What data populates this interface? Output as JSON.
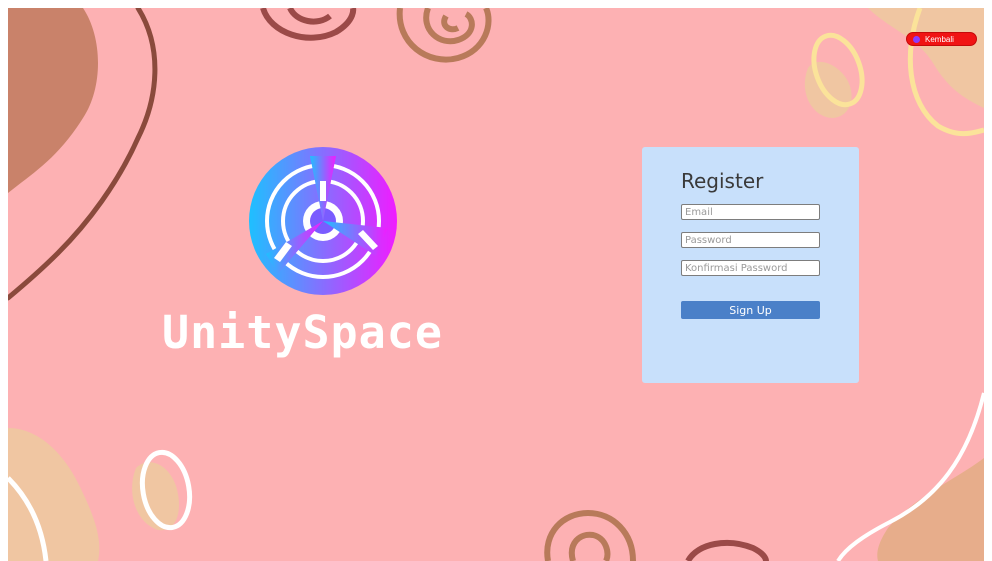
{
  "page": {
    "brand_name": "UnitySpace",
    "back_button_label": "Kembali"
  },
  "register": {
    "title": "Register",
    "email_placeholder": "Email",
    "email_value": "",
    "password_placeholder": "Password",
    "password_value": "",
    "confirm_password_placeholder": "Konfirmasi Password",
    "confirm_password_value": "",
    "signup_label": "Sign Up"
  },
  "colors": {
    "background": "#fdb1b3",
    "panel": "#c8e0fb",
    "signup_button": "#4a80c8",
    "back_button": "#f01414",
    "logo_gradient_start": "#1ec0ff",
    "logo_gradient_end": "#f01cff"
  },
  "icons": {
    "logo": "unityspace-logo-icon",
    "back_dot": "record-dot-icon"
  }
}
